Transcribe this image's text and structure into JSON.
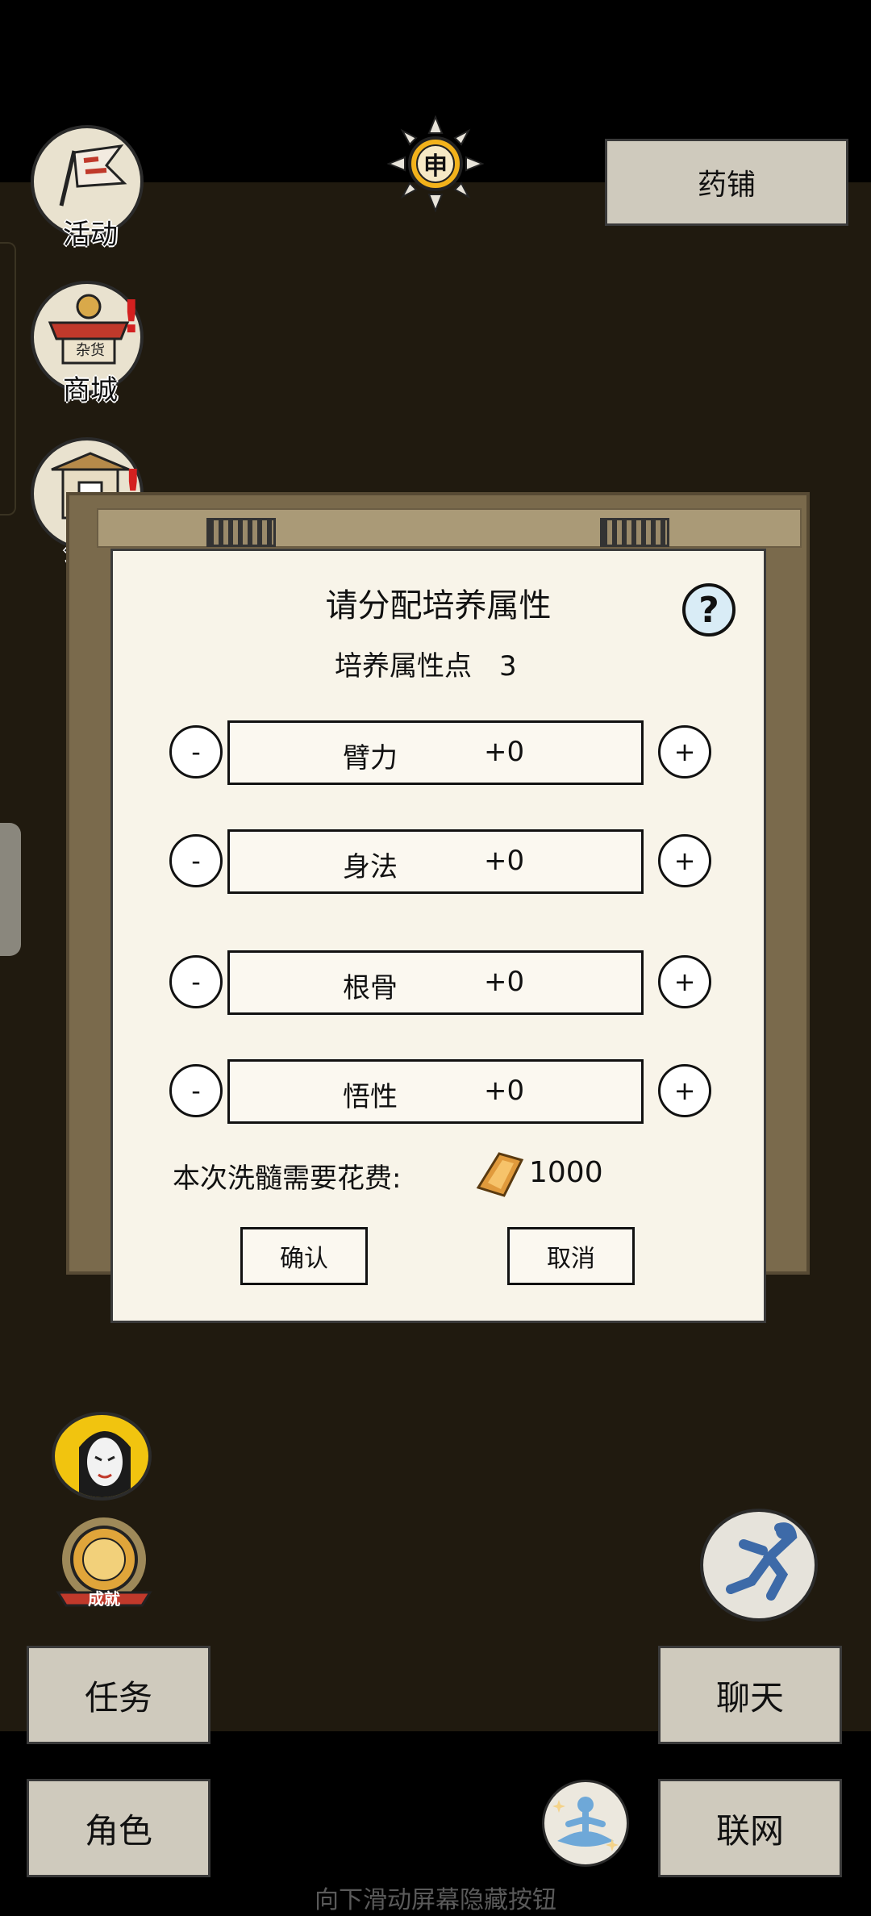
{
  "top": {
    "time_glyph": "申",
    "shop_label": "药铺"
  },
  "side": {
    "activity_label": "活动",
    "mall_label": "商城",
    "notice_label": "公告",
    "mall_badge": "!",
    "notice_badge": "!",
    "mall_sign": "杂货"
  },
  "dialog": {
    "title": "请分配培养属性",
    "help_label": "?",
    "points_label": "培养属性点",
    "points_value": "3",
    "attributes": [
      {
        "name": "臂力",
        "value": "+0"
      },
      {
        "name": "身法",
        "value": "+0"
      },
      {
        "name": "根骨",
        "value": "+0"
      },
      {
        "name": "悟性",
        "value": "+0"
      }
    ],
    "minus_label": "-",
    "plus_label": "+",
    "cost_label": "本次洗髓需要花费:",
    "cost_value": "1000",
    "confirm_label": "确认",
    "cancel_label": "取消"
  },
  "achievement_label": "成就",
  "bottom": {
    "task_label": "任务",
    "role_label": "角色",
    "chat_label": "聊天",
    "network_label": "联网"
  },
  "hint": "向下滑动屏幕隐藏按钮",
  "colors": {
    "panel_bg": "#f8f4e9",
    "field_bg": "#201a0f",
    "button_bg": "#cfcabd",
    "badge": "#d32020",
    "gold": "#e09a3c",
    "help_bg": "#d9ecf6"
  }
}
